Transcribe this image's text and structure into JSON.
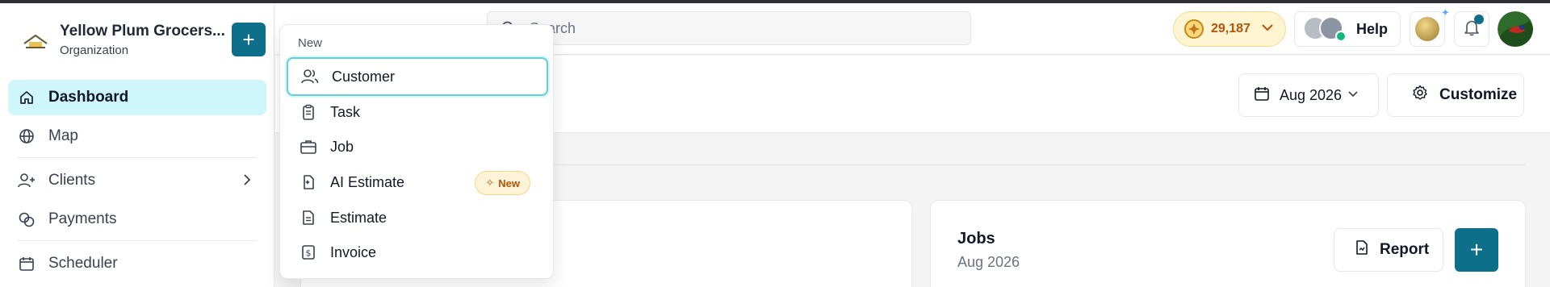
{
  "org": {
    "name": "Yellow Plum Grocers...",
    "subtitle": "Organization"
  },
  "sidebar": {
    "items": [
      {
        "label": "Dashboard",
        "icon": "home-icon",
        "active": true
      },
      {
        "label": "Map",
        "icon": "globe-icon"
      },
      {
        "label": "Clients",
        "icon": "user-plus-icon",
        "expandable": true
      },
      {
        "label": "Payments",
        "icon": "coins-icon"
      },
      {
        "label": "Scheduler",
        "icon": "calendar-icon"
      }
    ]
  },
  "topbar": {
    "search_placeholder": "Search",
    "coins_value": "29,187",
    "help_label": "Help"
  },
  "header": {
    "date_label": "Aug 2026",
    "customize_label": "Customize"
  },
  "jobs_card": {
    "title": "Jobs",
    "subtitle": "Aug 2026",
    "report_label": "Report"
  },
  "new_menu": {
    "title": "New",
    "items": [
      {
        "label": "Customer",
        "icon": "users-icon",
        "focused": true
      },
      {
        "label": "Task",
        "icon": "clipboard-icon"
      },
      {
        "label": "Job",
        "icon": "briefcase-icon"
      },
      {
        "label": "AI Estimate",
        "icon": "ai-estimate-icon",
        "badge": "New"
      },
      {
        "label": "Estimate",
        "icon": "document-list-icon"
      },
      {
        "label": "Invoice",
        "icon": "invoice-icon"
      }
    ]
  },
  "colors": {
    "brand": "#0e6f8a",
    "active_nav": "#cff7fb",
    "coins_bg": "#fdf4d2",
    "coins_text": "#b45309",
    "focus_ring": "#5fd0dc"
  }
}
